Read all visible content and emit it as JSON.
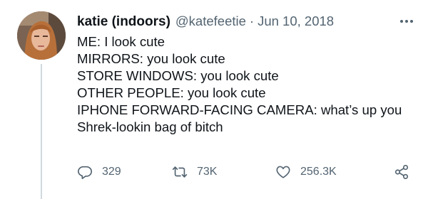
{
  "tweet": {
    "author": {
      "display_name": "katie (indoors)",
      "handle": "@katefeetie",
      "separator": "·",
      "date": "Jun 10, 2018",
      "avatar_icon": "profile-photo"
    },
    "lines": [
      "ME: I look cute",
      "MIRRORS: you look cute",
      "STORE WINDOWS: you look cute",
      "OTHER PEOPLE: you look cute",
      "IPHONE FORWARD-FACING CAMERA: what’s up you",
      "Shrek-lookin bag of bitch"
    ],
    "actions": {
      "reply": {
        "icon": "reply-icon",
        "count": "329"
      },
      "retweet": {
        "icon": "retweet-icon",
        "count": "73K"
      },
      "like": {
        "icon": "heart-icon",
        "count": "256.3K"
      },
      "share": {
        "icon": "share-icon"
      }
    },
    "more_icon": "more-icon"
  },
  "colors": {
    "text_primary": "#0f1419",
    "text_secondary": "#536471",
    "thread_line": "#cfd9de"
  }
}
